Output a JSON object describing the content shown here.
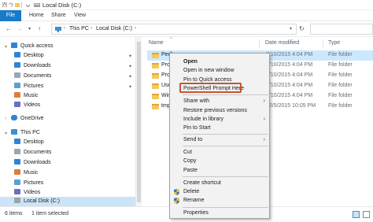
{
  "window": {
    "title": "Local Disk (C:)"
  },
  "ribbon": {
    "tabs": [
      "File",
      "Home",
      "Share",
      "View"
    ]
  },
  "address": {
    "crumbs": [
      "This PC",
      "Local Disk (C:)"
    ],
    "back_icon": "back-arrow-icon",
    "forward_icon": "forward-arrow-icon"
  },
  "navpane": {
    "quick_access": "Quick access",
    "quick_items": [
      "Desktop",
      "Downloads",
      "Documents",
      "Pictures",
      "Music",
      "Videos"
    ],
    "onedrive": "OneDrive",
    "this_pc": "This PC",
    "pc_items": [
      "Desktop",
      "Documents",
      "Downloads",
      "Music",
      "Pictures",
      "Videos"
    ],
    "local_disk": "Local Disk (C:)"
  },
  "filelist": {
    "columns": [
      "Name",
      "Date modified",
      "Type"
    ],
    "rows": [
      {
        "name": "PerfL",
        "date": "7/10/2015 4:04 PM",
        "type": "File folder"
      },
      {
        "name": "Progr",
        "date": "7/10/2015 4:04 PM",
        "type": "File folder"
      },
      {
        "name": "Progr",
        "date": "7/10/2015 4:04 PM",
        "type": "File folder"
      },
      {
        "name": "Users",
        "date": "7/10/2015 4:04 PM",
        "type": "File folder"
      },
      {
        "name": "Windo",
        "date": "7/10/2015 4:04 PM",
        "type": "File folder"
      },
      {
        "name": "tmp",
        "date": "12/5/2015 10:05 PM",
        "type": "File folder"
      }
    ],
    "row_colors": {
      "folder": "#f4c95d",
      "selected": "#cce8ff"
    }
  },
  "context_menu": {
    "open": "Open",
    "open_new_window": "Open in new window",
    "pin_quick_access": "Pin to Quick access",
    "powershell": "PowerShell Prompt Here",
    "share_with": "Share with",
    "restore_versions": "Restore previous versions",
    "include_library": "Include in library",
    "pin_start": "Pin to Start",
    "send_to": "Send to",
    "cut": "Cut",
    "copy": "Copy",
    "paste": "Paste",
    "create_shortcut": "Create shortcut",
    "delete": "Delete",
    "rename": "Rename",
    "properties": "Properties",
    "highlight_color": "#c9542c"
  },
  "status": {
    "items": "6 items",
    "selected": "1 item selected"
  },
  "colors": {
    "accent": "#1979ca",
    "nav_selected": "#cce4f7"
  }
}
